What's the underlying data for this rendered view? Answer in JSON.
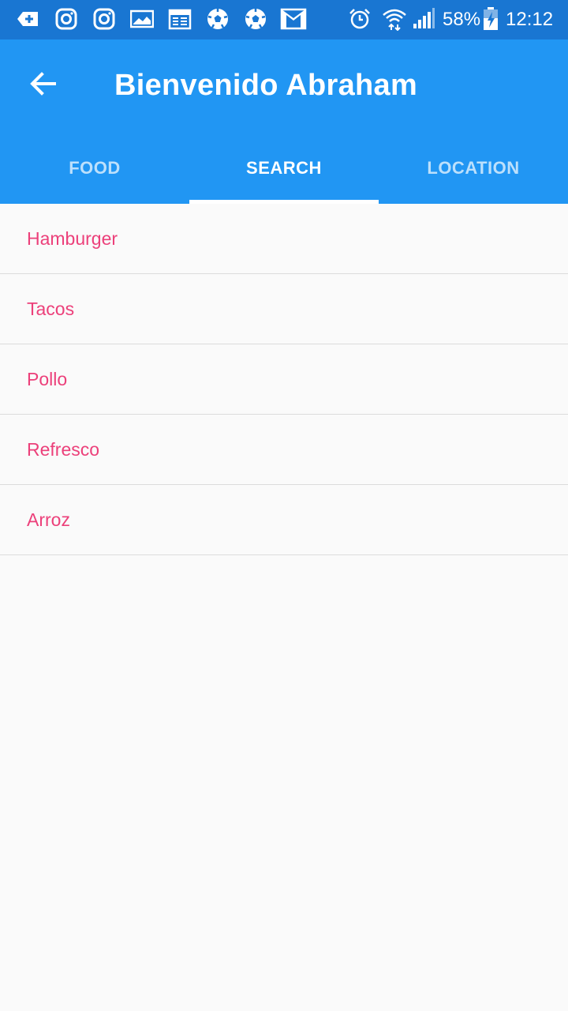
{
  "status_bar": {
    "battery": "58%",
    "time": "12:12",
    "icons": [
      "add-tab-icon",
      "instagram-icon",
      "instagram-icon",
      "image-icon",
      "calendar-icon",
      "soccer-ball-icon",
      "soccer-ball-icon",
      "gmail-icon",
      "alarm-icon",
      "wifi-icon",
      "signal-icon",
      "battery-charging-icon"
    ]
  },
  "app_bar": {
    "title": "Bienvenido Abraham",
    "back_icon": "arrow-back-icon",
    "color": "#2196f3"
  },
  "tabs": [
    {
      "label": "FOOD",
      "active": false
    },
    {
      "label": "SEARCH",
      "active": true
    },
    {
      "label": "LOCATION",
      "active": false
    }
  ],
  "list": {
    "item_color": "#ec407a",
    "items": [
      {
        "label": "Hamburger"
      },
      {
        "label": "Tacos"
      },
      {
        "label": "Pollo"
      },
      {
        "label": "Refresco"
      },
      {
        "label": "Arroz"
      }
    ]
  }
}
